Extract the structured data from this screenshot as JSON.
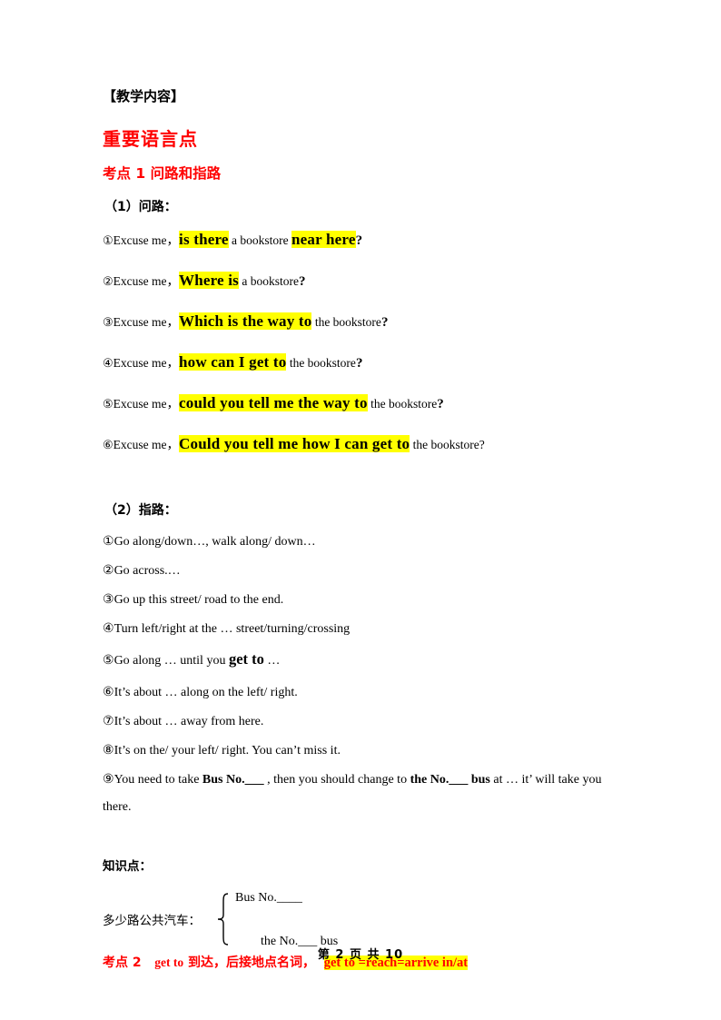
{
  "document": {
    "teaching_content_heading": "【教学内容】",
    "main_heading": "重要语言点",
    "point1_heading": "考点 1    问路和指路",
    "colors": {
      "heading_red": "#ff0000",
      "highlight_yellow": "#ffff00",
      "text_black": "#000000"
    }
  },
  "section_ask": {
    "subheading": "（1）问路：",
    "items": [
      {
        "num": "①",
        "lead": "Excuse me，",
        "hl1": "is there",
        "mid": " a bookstore ",
        "hl2": "near here",
        "tail": "?"
      },
      {
        "num": "②",
        "lead": "Excuse me，",
        "hl1": "Where is",
        "mid": " a bookstore",
        "hl2": "",
        "tail": "?"
      },
      {
        "num": "③",
        "lead": "Excuse me，",
        "hl1": "Which is the way to",
        "mid": " the bookstore",
        "hl2": "",
        "tail": "?"
      },
      {
        "num": "④",
        "lead": "Excuse me，",
        "hl1": "how can I get to",
        "mid": " the bookstore",
        "hl2": "",
        "tail": "?"
      },
      {
        "num": "⑤",
        "lead": "Excuse me，",
        "hl1": "could you tell me the way to",
        "mid": " the bookstore",
        "hl2": "",
        "tail": "?"
      },
      {
        "num": "⑥",
        "lead": "Excuse me，",
        "hl1": "Could you tell me how I can get to",
        "mid": " the bookstore?",
        "hl2": "",
        "tail": ""
      }
    ]
  },
  "section_directions": {
    "subheading": "（2）指路：",
    "items": [
      {
        "num": "①",
        "text": "Go along/down…, walk along/ down…"
      },
      {
        "num": "②",
        "text": "Go across.…"
      },
      {
        "num": "③",
        "text": "Go up this street/ road to the end."
      },
      {
        "num": "④",
        "text": "Turn left/right at the … street/turning/crossing"
      },
      {
        "num": "⑤",
        "pre": "Go along … until you ",
        "emph": "get to",
        "post": " …"
      },
      {
        "num": "⑥",
        "text": "It’s about … along on the left/ right."
      },
      {
        "num": "⑦",
        "text": "It’s about … away from here."
      },
      {
        "num": "⑧",
        "text": "It’s on the/ your left/ right. You can’t miss it."
      },
      {
        "num": "⑨",
        "p1": "You need to take ",
        "b1": "Bus No.___",
        "p2": " , then you should change to ",
        "b2": "the No.___ bus",
        "p3": " at … it’ will take you",
        "p4": "there."
      }
    ]
  },
  "knowledge_point": {
    "heading": "知识点：",
    "label": "多少路公共汽车：",
    "brace_items": [
      "Bus No.____",
      "the No.___ bus"
    ]
  },
  "point2": {
    "label": "考点 2",
    "english": "get to",
    "chinese": "到达，后接地点名词，",
    "highlight": "get to =reach=arrive in/at"
  },
  "footer": {
    "text": "第 2 页 共 10"
  }
}
